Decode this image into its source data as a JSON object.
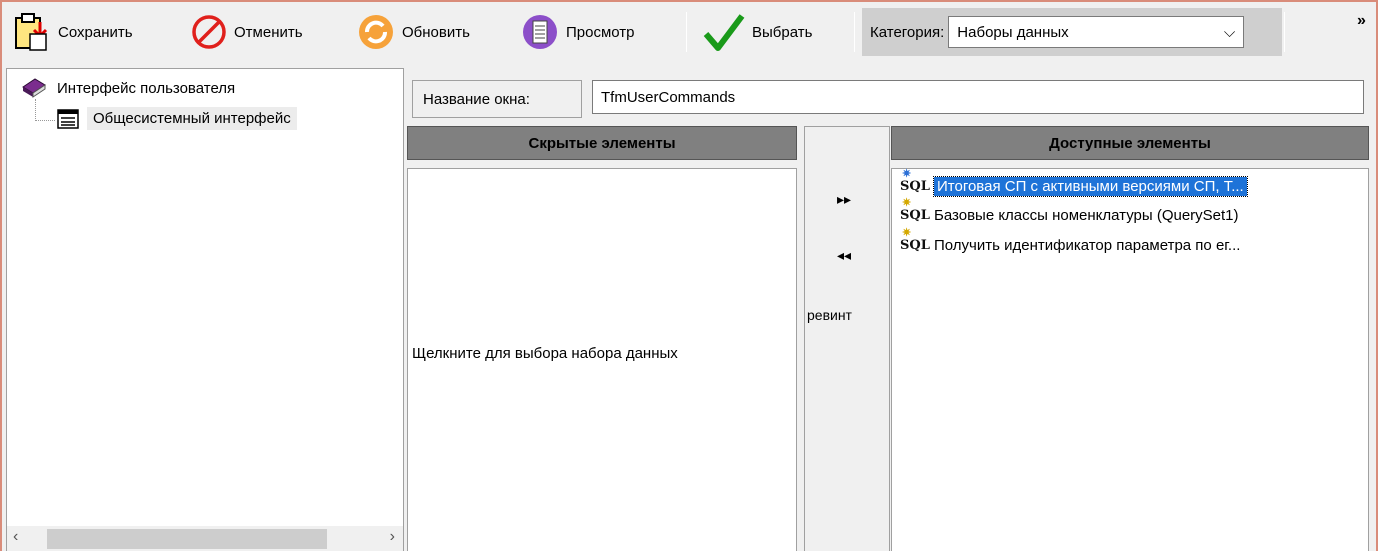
{
  "toolbar": {
    "save_label": "Сохранить",
    "cancel_label": "Отменить",
    "refresh_label": "Обновить",
    "view_label": "Просмотр",
    "select_label": "Выбрать",
    "category_label": "Категория:",
    "category_value": "Наборы данных",
    "more": "»"
  },
  "tree": {
    "root_label": "Интерфейс пользователя",
    "child_label": "Общесистемный интерфейс"
  },
  "window_name": {
    "label": "Название окна:",
    "value": "TfmUserCommands"
  },
  "hidden_panel": {
    "header": "Скрытые элементы",
    "hint": "Щелкните для выбора набора данных"
  },
  "middle": {
    "move_right": "▸▸",
    "move_left": "◂◂",
    "edit_text": "ревинт"
  },
  "available_panel": {
    "header": "Доступные элементы",
    "items": [
      {
        "sql": "SQL",
        "label": "Итоговая СП с активными версиями СП, Т..."
      },
      {
        "sql": "SQL",
        "label": "Базовые классы номенклатуры (QuerySet1)"
      },
      {
        "sql": "SQL",
        "label": "Получить идентификатор параметра по ег..."
      }
    ]
  },
  "colors": {
    "selection": "#1e73d8",
    "panel_header": "#808080",
    "frame_border": "#d98c7a"
  }
}
